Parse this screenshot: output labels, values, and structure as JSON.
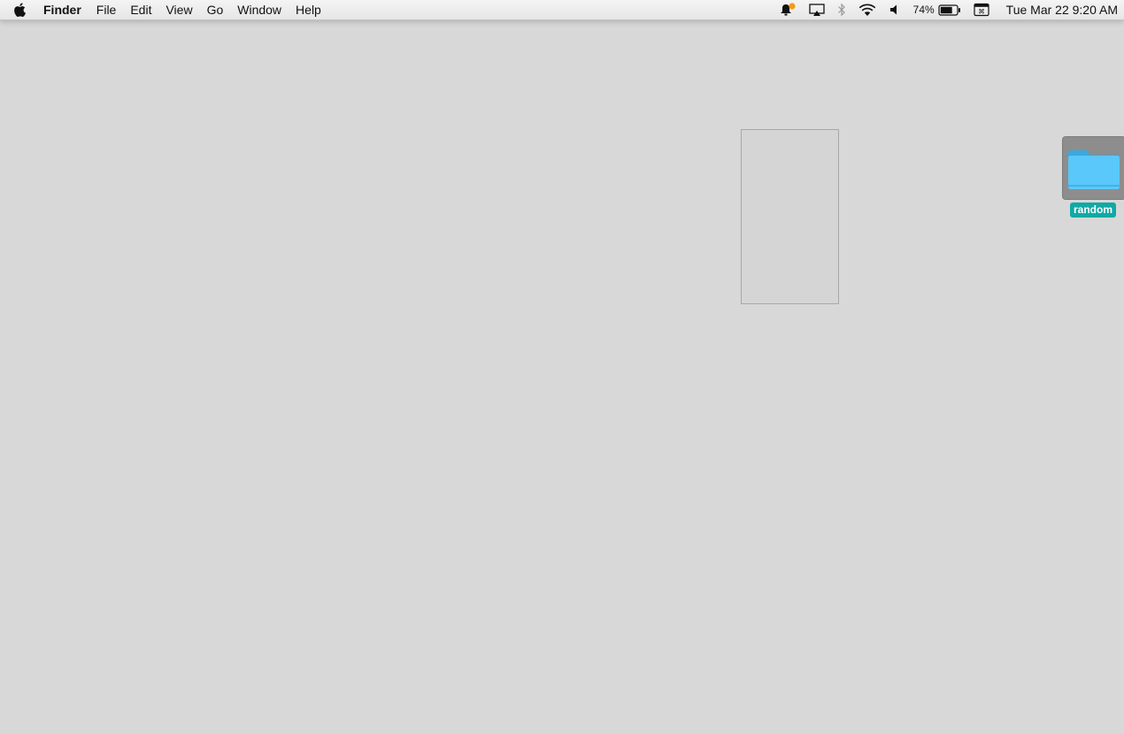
{
  "menubar": {
    "app_name": "Finder",
    "menus": [
      "File",
      "Edit",
      "View",
      "Go",
      "Window",
      "Help"
    ],
    "status_icons": [
      "notification-icon",
      "airplay-icon",
      "bluetooth-icon",
      "wifi-icon",
      "volume-icon",
      "battery-icon",
      "input-menu-icon"
    ],
    "battery_percent": "74%",
    "battery_level": 0.74,
    "clock": "Tue Mar 22  9:20 AM"
  },
  "desktop": {
    "background": "#d8d8d8",
    "icons": [
      {
        "label": "random",
        "type": "folder",
        "selected": true
      }
    ]
  },
  "colors": {
    "folder_blue": "#5ac8fa",
    "label_highlight": "#11a9a4",
    "notification_dot": "#f39c12"
  }
}
